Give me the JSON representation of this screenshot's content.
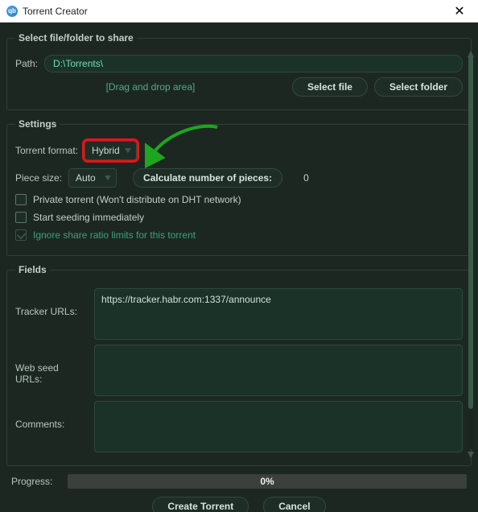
{
  "titlebar": {
    "title": "Torrent Creator"
  },
  "share": {
    "legend": "Select file/folder to share",
    "path_label": "Path:",
    "path_value": "D:\\Torrents\\",
    "drag_hint": "[Drag and drop area]",
    "select_file": "Select file",
    "select_folder": "Select folder"
  },
  "settings": {
    "legend": "Settings",
    "format_label": "Torrent format:",
    "format_value": "Hybrid",
    "piece_label": "Piece size:",
    "piece_value": "Auto",
    "calc_label": "Calculate number of pieces:",
    "pieces_count": "0",
    "private_label": "Private torrent (Won't distribute on DHT network)",
    "start_seed_label": "Start seeding immediately",
    "ignore_ratio_label": "Ignore share ratio limits for this torrent"
  },
  "fields": {
    "legend": "Fields",
    "tracker_label": "Tracker URLs:",
    "tracker_value": "https://tracker.habr.com:1337/announce",
    "webseed_label": "Web seed URLs:",
    "webseed_value": "",
    "comments_label": "Comments:",
    "comments_value": ""
  },
  "progress": {
    "label": "Progress:",
    "text": "0%"
  },
  "buttons": {
    "create": "Create Torrent",
    "cancel": "Cancel"
  }
}
